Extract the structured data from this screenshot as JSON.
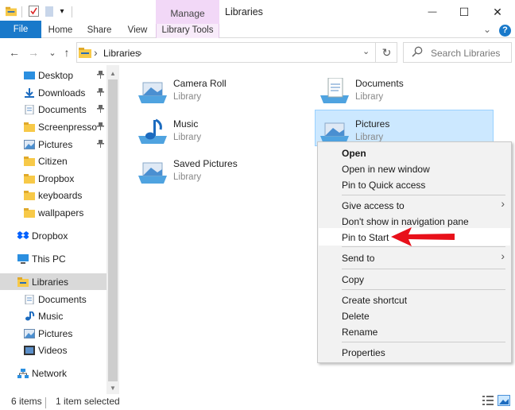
{
  "window": {
    "title": "Libraries",
    "manage_tab": "Manage",
    "minimize_glyph": "—",
    "maximize_glyph": "☐",
    "close_glyph": "✕",
    "qat_dropdown_glyph": "▾"
  },
  "ribbon": {
    "file": "File",
    "tabs": [
      "Home",
      "Share",
      "View",
      "Library Tools"
    ],
    "collapse_glyph": "⌄",
    "help_glyph": "?"
  },
  "address": {
    "back_glyph": "←",
    "forward_glyph": "→",
    "recent_glyph": "⌄",
    "up_glyph": "↑",
    "separator_glyph": "›",
    "path": "Libraries",
    "dropdown_glyph": "⌄",
    "refresh_glyph": "↻",
    "search_placeholder": "Search Libraries"
  },
  "sidebar": {
    "items": [
      {
        "label": "Desktop",
        "pinned": true,
        "icon": "desktop-icon"
      },
      {
        "label": "Downloads",
        "pinned": true,
        "icon": "downloads-icon"
      },
      {
        "label": "Documents",
        "pinned": true,
        "icon": "documents-icon"
      },
      {
        "label": "Screenpresso",
        "pinned": true,
        "icon": "folder-icon"
      },
      {
        "label": "Pictures",
        "pinned": true,
        "icon": "pictures-icon"
      },
      {
        "label": "Citizen",
        "pinned": false,
        "icon": "folder-icon"
      },
      {
        "label": "Dropbox",
        "pinned": false,
        "icon": "folder-icon"
      },
      {
        "label": "keyboards",
        "pinned": false,
        "icon": "folder-icon"
      },
      {
        "label": "wallpapers",
        "pinned": false,
        "icon": "folder-icon"
      },
      {
        "label": "Dropbox",
        "pinned": false,
        "icon": "dropbox-icon"
      },
      {
        "label": "This PC",
        "pinned": false,
        "icon": "pc-icon"
      },
      {
        "label": "Libraries",
        "pinned": false,
        "icon": "libraries-icon",
        "selected": true
      },
      {
        "label": "Documents",
        "pinned": false,
        "icon": "documents-icon"
      },
      {
        "label": "Music",
        "pinned": false,
        "icon": "music-icon"
      },
      {
        "label": "Pictures",
        "pinned": false,
        "icon": "pictures-icon"
      },
      {
        "label": "Videos",
        "pinned": false,
        "icon": "videos-icon"
      },
      {
        "label": "Network",
        "pinned": false,
        "icon": "network-icon"
      }
    ],
    "pin_glyph": "📌",
    "scroll_up_glyph": "▲",
    "scroll_down_glyph": "▼"
  },
  "libraries": [
    {
      "name": "Camera Roll",
      "type": "Library",
      "icon": "camera-roll-library-icon"
    },
    {
      "name": "Documents",
      "type": "Library",
      "icon": "documents-library-icon"
    },
    {
      "name": "Music",
      "type": "Library",
      "icon": "music-library-icon"
    },
    {
      "name": "Pictures",
      "type": "Library",
      "icon": "pictures-library-icon",
      "selected": true
    },
    {
      "name": "Saved Pictures",
      "type": "Library",
      "icon": "saved-pictures-library-icon"
    }
  ],
  "context_menu": {
    "items": [
      "Open",
      "Open in new window",
      "Pin to Quick access",
      "Give access to",
      "Don't show in navigation pane",
      "Pin to Start",
      "Send to",
      "Copy",
      "Create shortcut",
      "Delete",
      "Rename",
      "Properties"
    ],
    "submenu_glyph": "›",
    "highlighted": "Pin to Start"
  },
  "status": {
    "count": "6 items",
    "selection": "1 item selected"
  },
  "colors": {
    "accent": "#1979ca",
    "selection": "#cce8ff",
    "manage_tab": "#f2d8f7",
    "annotation_arrow": "#e8101a"
  }
}
